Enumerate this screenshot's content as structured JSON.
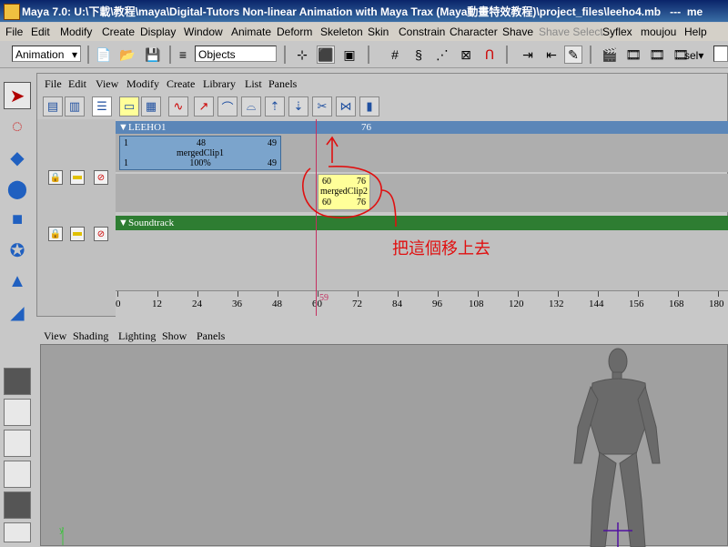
{
  "window": {
    "title": "Maya 7.0: U:\\下載\\教程\\maya\\Digital-Tutors Non-linear Animation with Maya Trax (Maya動畫特效教程)\\project_files\\leeho4.mb",
    "title_tail": "---",
    "title_right": "me"
  },
  "main_menu": [
    "File",
    "Edit",
    "Modify",
    "Create",
    "Display",
    "Window",
    "Animate",
    "Deform",
    "Skeleton",
    "Skin",
    "Constrain",
    "Character",
    "Shave",
    "Shave Select",
    "Syflex",
    "moujou",
    "Help"
  ],
  "main_menu_disabled": "Shave Select",
  "toolbar": {
    "menu_set": "Animation",
    "selection_field": "Objects",
    "right_field": "sel"
  },
  "trax": {
    "menu": [
      "File",
      "Edit",
      "View",
      "Modify",
      "Create",
      "Library",
      "List",
      "Panels"
    ],
    "character_name": "LEEHO1",
    "character_end": "76",
    "clip1": {
      "start": "1",
      "top_value": "48",
      "end": "49",
      "name": "mergedClip1",
      "scale": "100%",
      "bottom_start": "1",
      "bottom_end": "49"
    },
    "clip2": {
      "start": "60",
      "end": "76",
      "name": "mergedClip2",
      "bottom_start": "60",
      "bottom_end": "76"
    },
    "soundtrack": "Soundtrack",
    "current_frame": "59",
    "ruler_ticks": [
      "0",
      "12",
      "24",
      "36",
      "48",
      "60",
      "72",
      "84",
      "96",
      "108",
      "120",
      "132",
      "144",
      "156",
      "168",
      "180"
    ]
  },
  "annotation": "把這個移上去",
  "viewport": {
    "menu": [
      "View",
      "Shading",
      "Lighting",
      "Show",
      "Panels"
    ]
  },
  "colors": {
    "accent_red": "#e01010",
    "character_bar": "#5b86b8",
    "clip1": "#7ba4cc",
    "clip2": "#ffff99",
    "soundtrack": "#2e7d32"
  }
}
